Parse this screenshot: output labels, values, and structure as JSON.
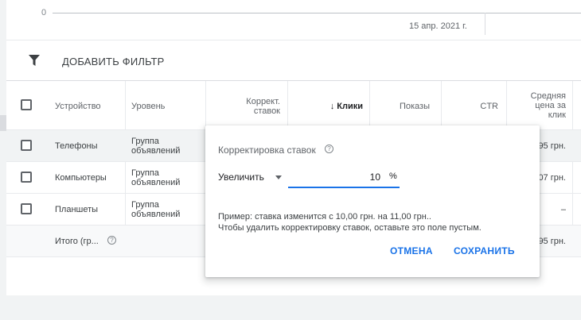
{
  "chart": {
    "zero_label": "0",
    "date_label": "15 апр. 2021 г."
  },
  "filter": {
    "label": "ДОБАВИТЬ ФИЛЬТР",
    "icon": "filter-icon"
  },
  "table": {
    "headers": {
      "device": "Устройство",
      "level": "Уровень",
      "adj_line1": "Коррект.",
      "adj_line2": "ставок",
      "clicks": "↓ Клики",
      "impressions": "Показы",
      "ctr": "CTR",
      "cpc_line1": "Средняя",
      "cpc_line2": "цена за",
      "cpc_line3": "клик"
    },
    "rows": [
      {
        "device": "Телефоны",
        "level_line1": "Группа",
        "level_line2": "объявлений",
        "cpc": "95 грн."
      },
      {
        "device": "Компьютеры",
        "level_line1": "Группа",
        "level_line2": "объявлений",
        "cpc": "07 грн."
      },
      {
        "device": "Планшеты",
        "level_line1": "Группа",
        "level_line2": "объявлений",
        "cpc": "–"
      }
    ],
    "total": {
      "label": "Итого (гр...",
      "cpc": "95 грн."
    }
  },
  "popup": {
    "title": "Корректировка ставок",
    "help": "?",
    "dropdown_value": "Увеличить",
    "input_value": "10",
    "suffix": "%",
    "example_line1": "Пример: ставка изменится с 10,00 грн. на 11,00 грн..",
    "example_line2": "Чтобы удалить корректировку ставок, оставьте это поле пустым.",
    "cancel_label": "ОТМЕНА",
    "save_label": "СОХРАНИТЬ"
  },
  "colors": {
    "accent": "#1a73e8",
    "text": "#3c4043",
    "muted": "#5f6368"
  }
}
